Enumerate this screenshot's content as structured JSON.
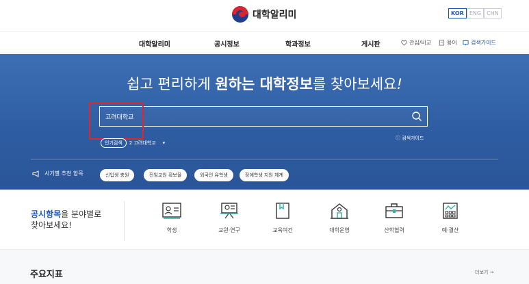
{
  "header": {
    "logo_text": "대학알리미",
    "languages": [
      "KOR",
      "ENG",
      "CHN"
    ],
    "active_language": "KOR"
  },
  "nav": {
    "items": [
      "대학알리미",
      "공시정보",
      "학과정보",
      "게시판"
    ],
    "utils": [
      "관심/비교",
      "용어",
      "검색가이드"
    ]
  },
  "hero": {
    "title_prefix": "쉽고 편리하게 ",
    "title_bold1": "원하는 대학정보",
    "title_suffix": "를 찾아보세요",
    "title_mark": "!",
    "search_value": "고려대학교",
    "popular_badge": "인기검색",
    "popular_item": "2 고려대학교",
    "guide_link": "검색가이드",
    "season_label": "시기별 추천 항목",
    "chips": [
      "신입생 충원",
      "전임교원 확보율",
      "외국인 유학생",
      "장애학생 지원 체계"
    ]
  },
  "categories": {
    "lead_bold": "공시항목",
    "lead_rest": "을 분야별로",
    "lead_line2": "찾아보세요!",
    "items": [
      {
        "label": "학생",
        "icon": "student-card-icon"
      },
      {
        "label": "교원·연구",
        "icon": "presentation-board-icon"
      },
      {
        "label": "교육여건",
        "icon": "book-icon"
      },
      {
        "label": "대학운영",
        "icon": "university-building-icon"
      },
      {
        "label": "산학협력",
        "icon": "briefcase-icon"
      },
      {
        "label": "예·결산",
        "icon": "finance-chart-icon"
      }
    ]
  },
  "indicators": {
    "title": "주요지표",
    "more": "더보기 →"
  },
  "colors": {
    "brand_blue": "#1e55b3",
    "hero_bg": "#2f5da3",
    "highlight_red": "#e3262c"
  }
}
